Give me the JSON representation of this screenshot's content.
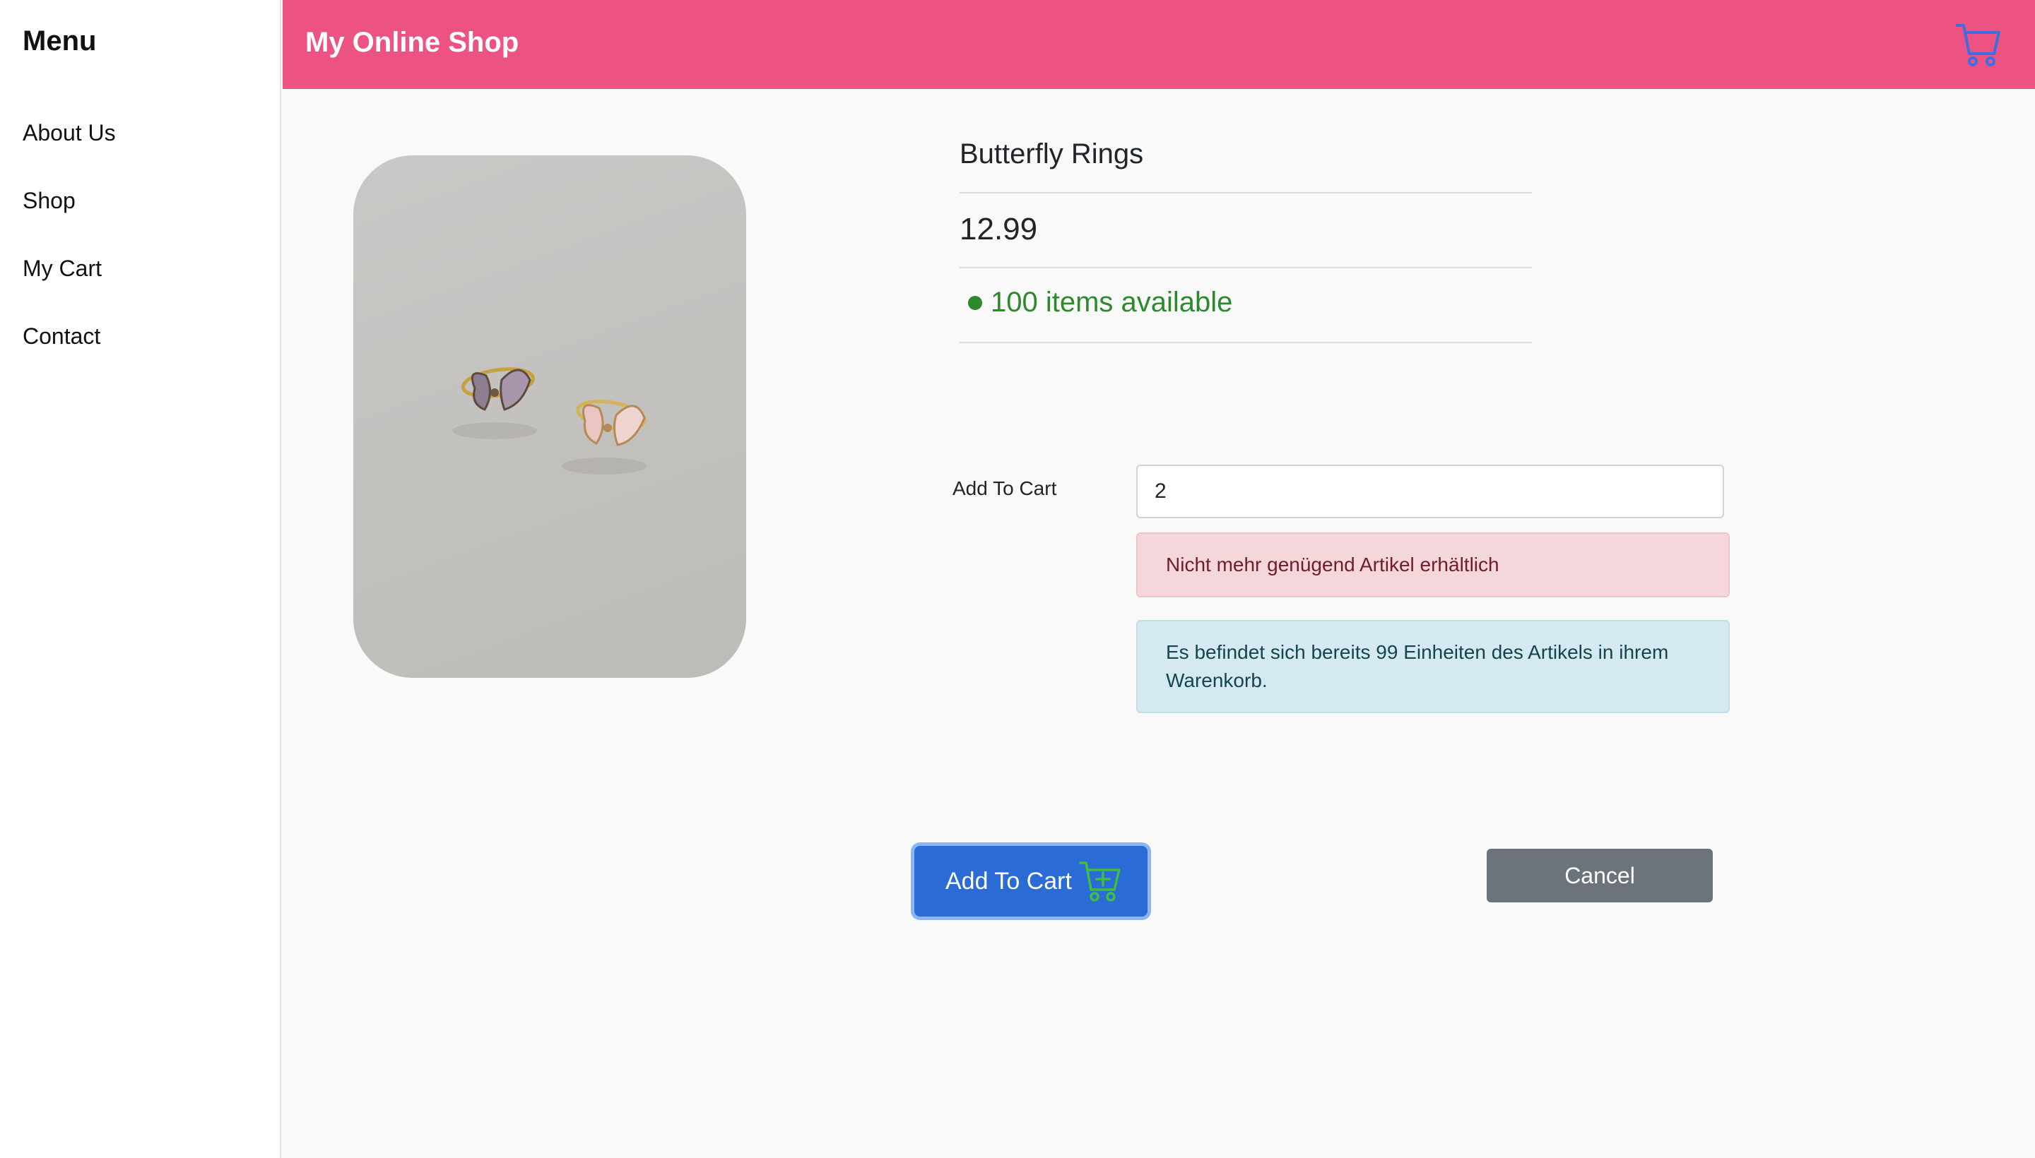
{
  "sidebar": {
    "title": "Menu",
    "items": [
      {
        "label": "About Us"
      },
      {
        "label": "Shop"
      },
      {
        "label": "My Cart"
      },
      {
        "label": "Contact"
      }
    ]
  },
  "header": {
    "title": "My Online Shop",
    "cart_icon": "cart-icon"
  },
  "product": {
    "name": "Butterfly Rings",
    "price": "12.99",
    "stock": "100 items available",
    "image_alt": "Two butterfly rings on a grey surface"
  },
  "form": {
    "quantity_label": "Add To Cart",
    "quantity_value": "2",
    "alert_danger": "Nicht mehr genügend Artikel erhältlich",
    "alert_info": "Es befindet sich bereits 99 Einheiten des Artikels in ihrem Warenkorb."
  },
  "buttons": {
    "add_to_cart": "Add To Cart",
    "add_to_cart_icon": "cart-plus-icon",
    "cancel": "Cancel"
  },
  "colors": {
    "header_bg": "#ec5282",
    "stock_green": "#2c8a2c",
    "primary_button": "#2a6bd6",
    "secondary_button": "#6c737a"
  }
}
